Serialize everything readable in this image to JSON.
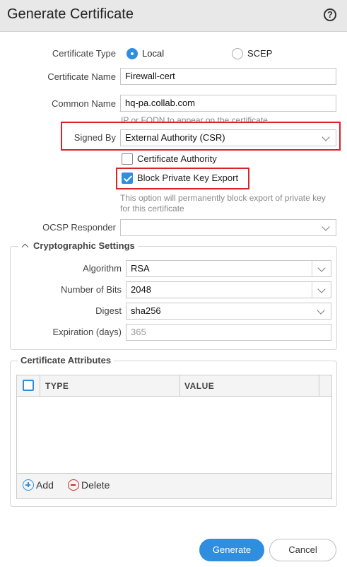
{
  "dialog": {
    "title": "Generate Certificate",
    "help_icon": "?"
  },
  "form": {
    "certificate_type": {
      "label": "Certificate Type",
      "options": [
        "Local",
        "SCEP"
      ],
      "selected": "Local"
    },
    "certificate_name": {
      "label": "Certificate Name",
      "value": "Firewall-cert"
    },
    "common_name": {
      "label": "Common Name",
      "value": "hq-pa.collab.com",
      "hint": "IP or FQDN to appear on the certificate"
    },
    "signed_by": {
      "label": "Signed By",
      "value": "External Authority (CSR)"
    },
    "certificate_authority": {
      "label": "Certificate Authority",
      "checked": false
    },
    "block_private_key_export": {
      "label": "Block Private Key Export",
      "checked": true,
      "hint_line1": "This option will permanently block export of private key",
      "hint_line2": "for this certificate"
    },
    "ocsp_responder": {
      "label": "OCSP Responder",
      "value": ""
    }
  },
  "crypto": {
    "title": "Cryptographic Settings",
    "algorithm": {
      "label": "Algorithm",
      "value": "RSA"
    },
    "number_of_bits": {
      "label": "Number of Bits",
      "value": "2048"
    },
    "digest": {
      "label": "Digest",
      "value": "sha256"
    },
    "expiration": {
      "label": "Expiration (days)",
      "placeholder": "365"
    }
  },
  "attributes": {
    "title": "Certificate Attributes",
    "columns": [
      "TYPE",
      "VALUE"
    ],
    "rows": [],
    "add_label": "Add",
    "delete_label": "Delete"
  },
  "footer": {
    "generate_label": "Generate",
    "cancel_label": "Cancel"
  },
  "colors": {
    "accent": "#2f8ee0",
    "highlight_box": "#d8232a",
    "danger": "#d8232a"
  }
}
